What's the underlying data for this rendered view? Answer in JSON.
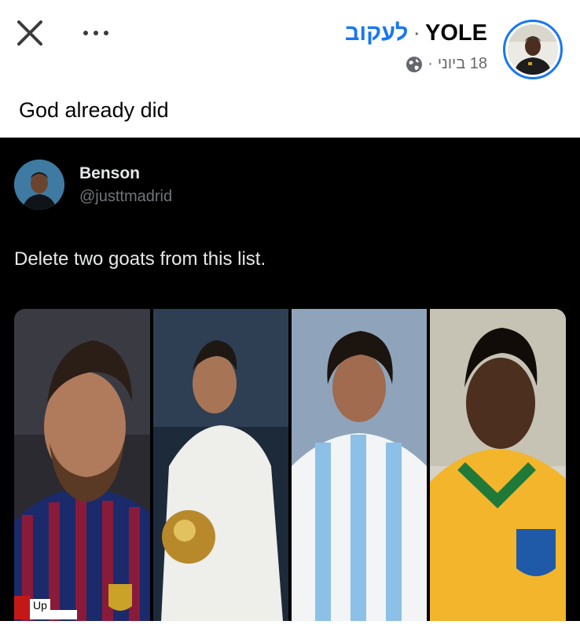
{
  "post": {
    "author": "YOLE",
    "separator": "·",
    "follow_label": "לעקוב",
    "date": "18 ביוני",
    "meta_separator": "·",
    "caption": "God already did",
    "icons": {
      "close": "close-icon",
      "more": "more-icon",
      "audience": "globe-icon"
    }
  },
  "tweet": {
    "name": "Benson",
    "handle": "@justtmadrid",
    "text": "Delete two goats from this list.",
    "watermark": "Up",
    "photos": [
      "messi-photo",
      "ronaldo-photo",
      "maradona-photo",
      "pele-photo"
    ]
  },
  "colors": {
    "accent": "#1877f2",
    "tweet_bg": "#000000",
    "text_muted": "#65676b"
  }
}
